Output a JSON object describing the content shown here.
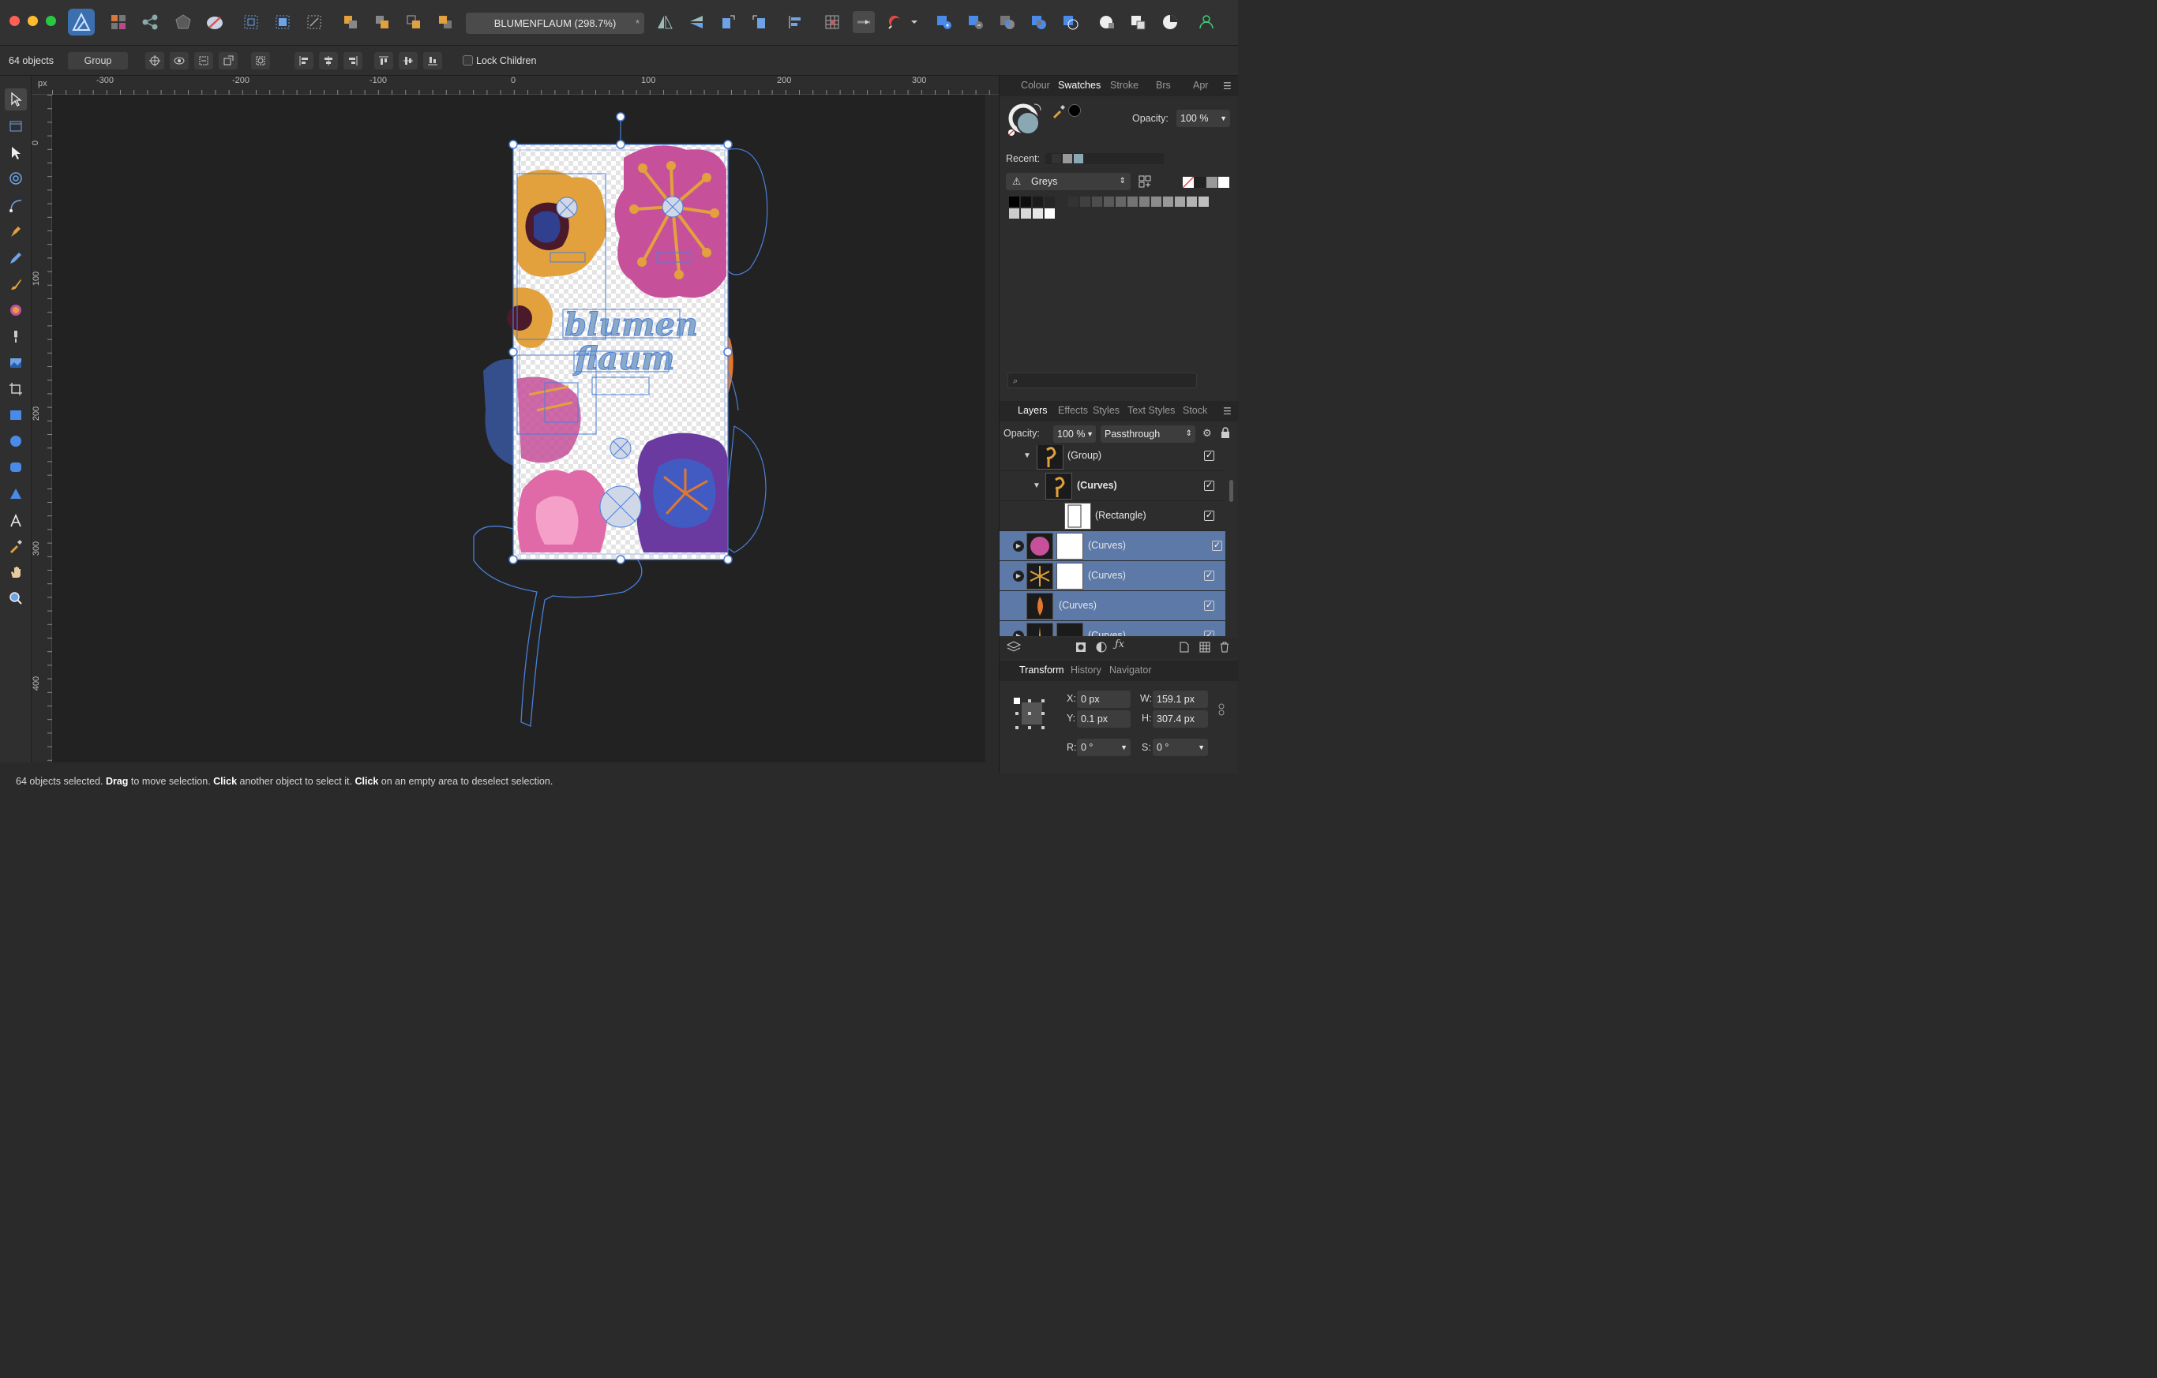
{
  "toolbar": {
    "document_title": "BLUMENFLAUM (298.7%)",
    "modified_marker": "*"
  },
  "context": {
    "object_count": "64 objects",
    "group_button": "Group",
    "lock_children": "Lock Children"
  },
  "ruler": {
    "unit": "px",
    "h_labels": [
      "-300",
      "-200",
      "-100",
      "0",
      "100",
      "200",
      "300"
    ],
    "v_labels": [
      "0",
      "100",
      "200",
      "300",
      "400"
    ]
  },
  "canvas": {
    "artwork_text_1": "blumen",
    "artwork_text_2": "flaum"
  },
  "swatches_panel": {
    "tabs": [
      "Colour",
      "Swatches",
      "Stroke",
      "Brs",
      "Apr"
    ],
    "active_tab": "Swatches",
    "opacity_label": "Opacity:",
    "opacity_value": "100 %",
    "recent_label": "Recent:",
    "palette_name": "Greys",
    "search_placeholder": ""
  },
  "layers_panel": {
    "tabs": [
      "Layers",
      "Effects",
      "Styles",
      "Text Styles",
      "Stock"
    ],
    "active_tab": "Layers",
    "opacity_label": "Opacity:",
    "opacity_value": "100 %",
    "blend_mode": "Passthrough",
    "rows": [
      {
        "label": "(Group)",
        "bold": false,
        "selected": false
      },
      {
        "label": "(Curves)",
        "bold": true,
        "selected": false
      },
      {
        "label": "(Rectangle)",
        "bold": false,
        "selected": false
      },
      {
        "label": "(Curves)",
        "bold": false,
        "selected": true
      },
      {
        "label": "(Curves)",
        "bold": false,
        "selected": true
      },
      {
        "label": "(Curves)",
        "bold": false,
        "selected": true
      },
      {
        "label": "(Curves)",
        "bold": false,
        "selected": true
      }
    ]
  },
  "transform_panel": {
    "tabs": [
      "Transform",
      "History",
      "Navigator"
    ],
    "active_tab": "Transform",
    "x_label": "X:",
    "x_value": "0 px",
    "y_label": "Y:",
    "y_value": "0.1 px",
    "w_label": "W:",
    "w_value": "159.1 px",
    "h_label": "H:",
    "h_value": "307.4 px",
    "r_label": "R:",
    "r_value": "0 °",
    "s_label": "S:",
    "s_value": "0 °"
  },
  "status": {
    "part1": "64 objects selected. ",
    "drag": "Drag",
    "part2": " to move selection. ",
    "click1": "Click",
    "part3": " another object to select it. ",
    "click2": "Click",
    "part4": " on an empty area to deselect selection."
  },
  "colors": {
    "accent": "#4a8ae8",
    "selection_row": "#5c79a8",
    "pink": "#c7509a",
    "orange": "#e2a13c",
    "purple": "#6a3aa0"
  }
}
